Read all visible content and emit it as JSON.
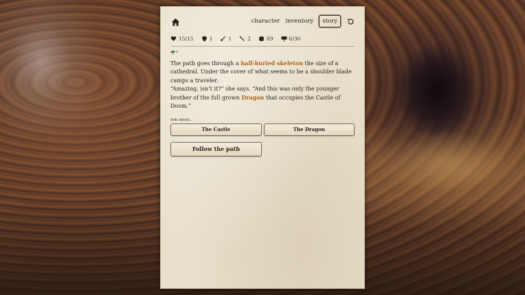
{
  "nav": {
    "character": "character",
    "inventory": "inventory",
    "story": "story"
  },
  "stats": {
    "health": "15/15",
    "armor": "1",
    "attack": "1",
    "magic": "2",
    "gold": "89",
    "progress": "6/30"
  },
  "buff": {
    "value": "4"
  },
  "story": {
    "p1_before": "The path goes through a ",
    "p1_highlight": "half-buried skeleton",
    "p1_after": " the size of a cathedral. Under the cover of what seems to be a shoulder blade camps a traveler.",
    "p2_before": "“Amazing, isn’t it?” she says. “And this was only the younger brother of the full grown ",
    "p2_highlight": "Dragon",
    "p2_after": " that occupies the Castle of Doom.”"
  },
  "ask": {
    "label": "Ask about...",
    "options": [
      "The Castle",
      "The Dragon"
    ]
  },
  "actions": {
    "follow": "Follow the path"
  },
  "icons": {
    "home": "home-icon",
    "refresh": "refresh-icon",
    "health": "heart-icon",
    "armor": "shield-icon",
    "attack": "sword-icon",
    "magic": "wand-icon",
    "gold": "coins-icon",
    "progress": "flag-icon",
    "buff": "herb-icon"
  },
  "colors": {
    "highlight": "#b0621a",
    "buff": "#3a6a2a",
    "parchment": "#e9e0cc"
  }
}
